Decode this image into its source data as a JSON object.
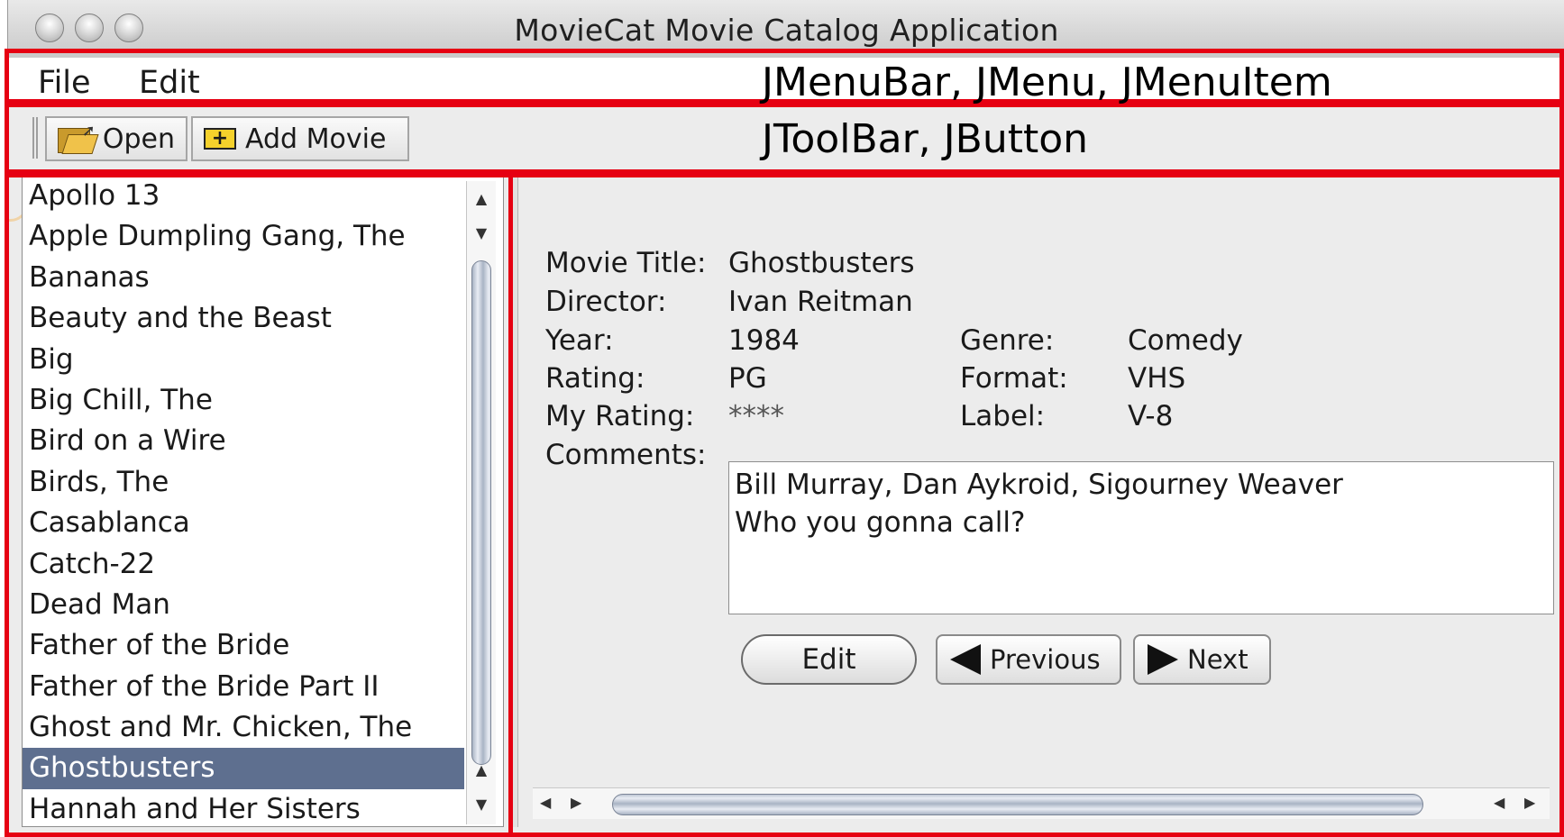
{
  "window": {
    "title": "MovieCat Movie Catalog Application"
  },
  "menubar": {
    "items": [
      {
        "label": "File"
      },
      {
        "label": "Edit"
      }
    ]
  },
  "toolbar": {
    "open_label": "Open",
    "add_label": "Add Movie",
    "open_icon": "folder-open-icon",
    "add_icon": "plus-icon"
  },
  "movie_list": {
    "items": [
      "Apollo 13",
      "Apple Dumpling Gang, The",
      "Bananas",
      "Beauty and the Beast",
      "Big",
      "Big Chill, The",
      "Bird on a Wire",
      "Birds, The",
      "Casablanca",
      "Catch-22",
      "Dead Man",
      "Father of the Bride",
      "Father of the Bride Part II",
      "Ghost and Mr. Chicken, The",
      "Ghostbusters",
      "Hannah and Her Sisters"
    ],
    "selected": "Ghostbusters"
  },
  "details": {
    "title_label": "Movie Title:",
    "title_value": "Ghostbusters",
    "director_label": "Director:",
    "director_value": "Ivan Reitman",
    "year_label": "Year:",
    "year_value": "1984",
    "genre_label": "Genre:",
    "genre_value": "Comedy",
    "rating_label": "Rating:",
    "rating_value": "PG",
    "format_label": "Format:",
    "format_value": "VHS",
    "myrating_label": "My Rating:",
    "myrating_value": "****",
    "label_label": "Label:",
    "label_value": "V-8",
    "comments_label": "Comments:",
    "comments_lines": [
      "Bill Murray, Dan Aykroid, Sigourney Weaver",
      "Who you gonna call?"
    ]
  },
  "buttons": {
    "edit": "Edit",
    "previous": "Previous",
    "next": "Next"
  },
  "annotations": {
    "menu": "JMenuBar, JMenu, JMenuItem",
    "toolbar": "JToolBar, JButton",
    "color": "#e60012"
  },
  "colors": {
    "selection": "#5e6f8f",
    "window_bg": "#ececec"
  }
}
